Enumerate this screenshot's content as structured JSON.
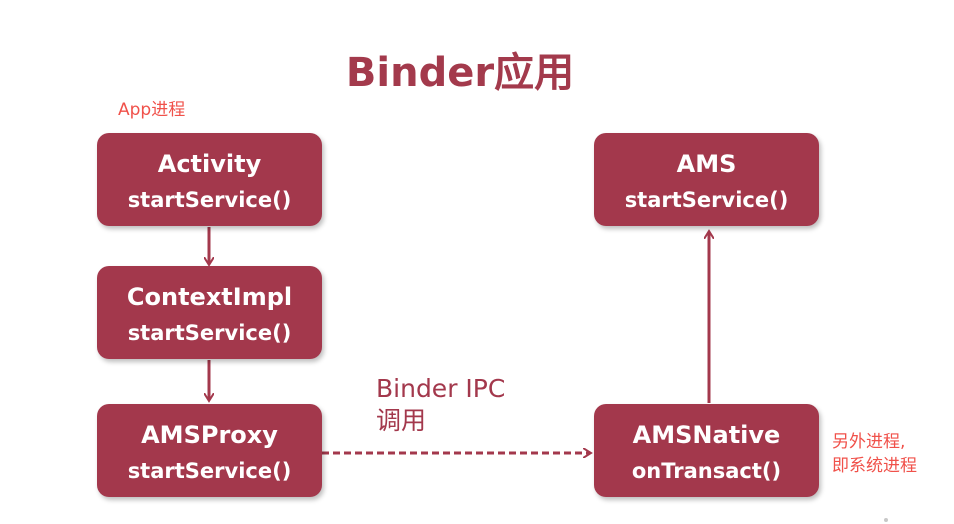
{
  "title": "Binder应用",
  "app_process_label": "App进程",
  "other_process_label_line1": "另外进程,",
  "other_process_label_line2": "即系统进程",
  "ipc_label_line1": "Binder IPC",
  "ipc_label_line2": "调用",
  "boxes": {
    "activity": {
      "name": "Activity",
      "method": "startService()"
    },
    "context_impl": {
      "name": "ContextImpl",
      "method": "startService()"
    },
    "ams_proxy": {
      "name": "AMSProxy",
      "method": "startService()"
    },
    "ams": {
      "name": "AMS",
      "method": "startService()"
    },
    "ams_native": {
      "name": "AMSNative",
      "method": "onTransact()"
    }
  },
  "colors": {
    "box_fill": "#a3384c",
    "title": "#a33a4c",
    "note": "#f0514a",
    "box_text": "#ffffff"
  }
}
